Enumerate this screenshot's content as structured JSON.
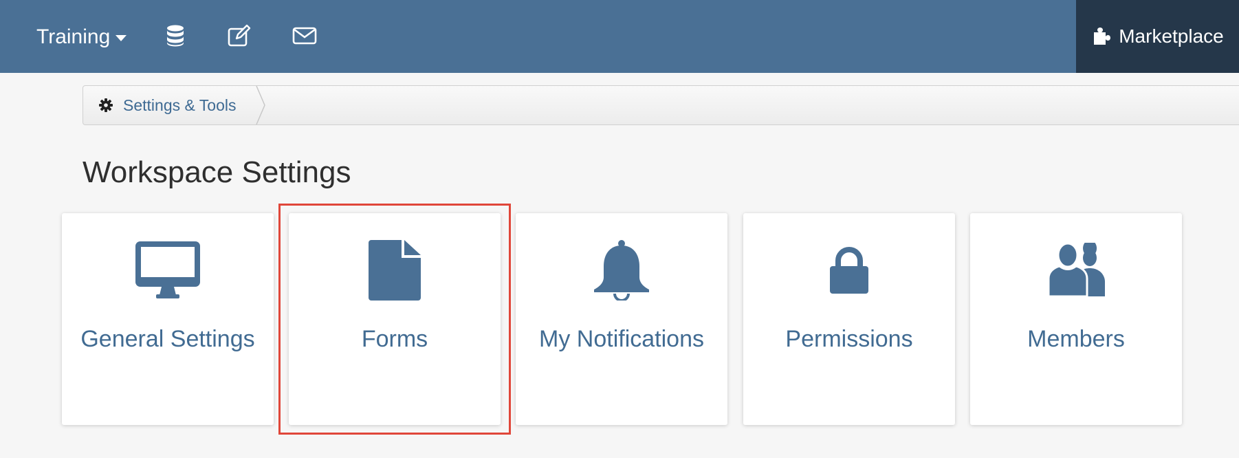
{
  "header": {
    "workspace_label": "Training",
    "icons": [
      "database-icon",
      "edit-icon",
      "mail-icon"
    ],
    "marketplace_label": "Marketplace"
  },
  "breadcrumb": {
    "label": "Settings & Tools"
  },
  "page_title": "Workspace Settings",
  "tiles": [
    {
      "label": "General Settings",
      "icon": "monitor-icon"
    },
    {
      "label": "Forms",
      "icon": "document-icon",
      "highlighted": true
    },
    {
      "label": "My Notifications",
      "icon": "bell-icon"
    },
    {
      "label": "Permissions",
      "icon": "lock-icon"
    },
    {
      "label": "Members",
      "icon": "users-icon"
    }
  ],
  "colors": {
    "topbar": "#4a7095",
    "marketplace_bg": "#25374a",
    "accent_text": "#416b92",
    "highlight_border": "#e0473a"
  }
}
